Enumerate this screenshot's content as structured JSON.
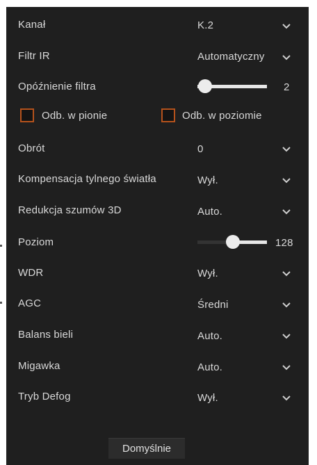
{
  "settings": {
    "channel": {
      "label": "Kanał",
      "value": "K.2"
    },
    "ir_filter": {
      "label": "Filtr IR",
      "value": "Automatyczny"
    },
    "filter_delay": {
      "label": "Opóźnienie filtra",
      "value": "2",
      "slider_level": 0.0
    },
    "flip_vertical": {
      "label": "Odb. w pionie",
      "checked": false
    },
    "flip_horizontal": {
      "label": "Odb. w poziomie",
      "checked": false
    },
    "rotation": {
      "label": "Obrót",
      "value": "0"
    },
    "backlight": {
      "label": "Kompensacja tylnego światła",
      "value": "Wył."
    },
    "noise_reduction": {
      "label": "Redukcja szumów 3D",
      "value": "Auto."
    },
    "level": {
      "label": "Poziom",
      "value": "128",
      "slider_level": 0.5
    },
    "wdr": {
      "label": "WDR",
      "value": "Wył."
    },
    "agc": {
      "label": "AGC",
      "value": "Średni"
    },
    "white_balance": {
      "label": "Balans bieli",
      "value": "Auto."
    },
    "shutter": {
      "label": "Migawka",
      "value": "Auto."
    },
    "defog": {
      "label": "Tryb Defog",
      "value": "Wył."
    }
  },
  "footer": {
    "default_label": "Domyślnie"
  },
  "colors": {
    "panel_bg": "#1f1f1f",
    "text": "#d9d9d9",
    "checkbox_border": "#b5521c",
    "slider_track": "#e6e6e6"
  }
}
